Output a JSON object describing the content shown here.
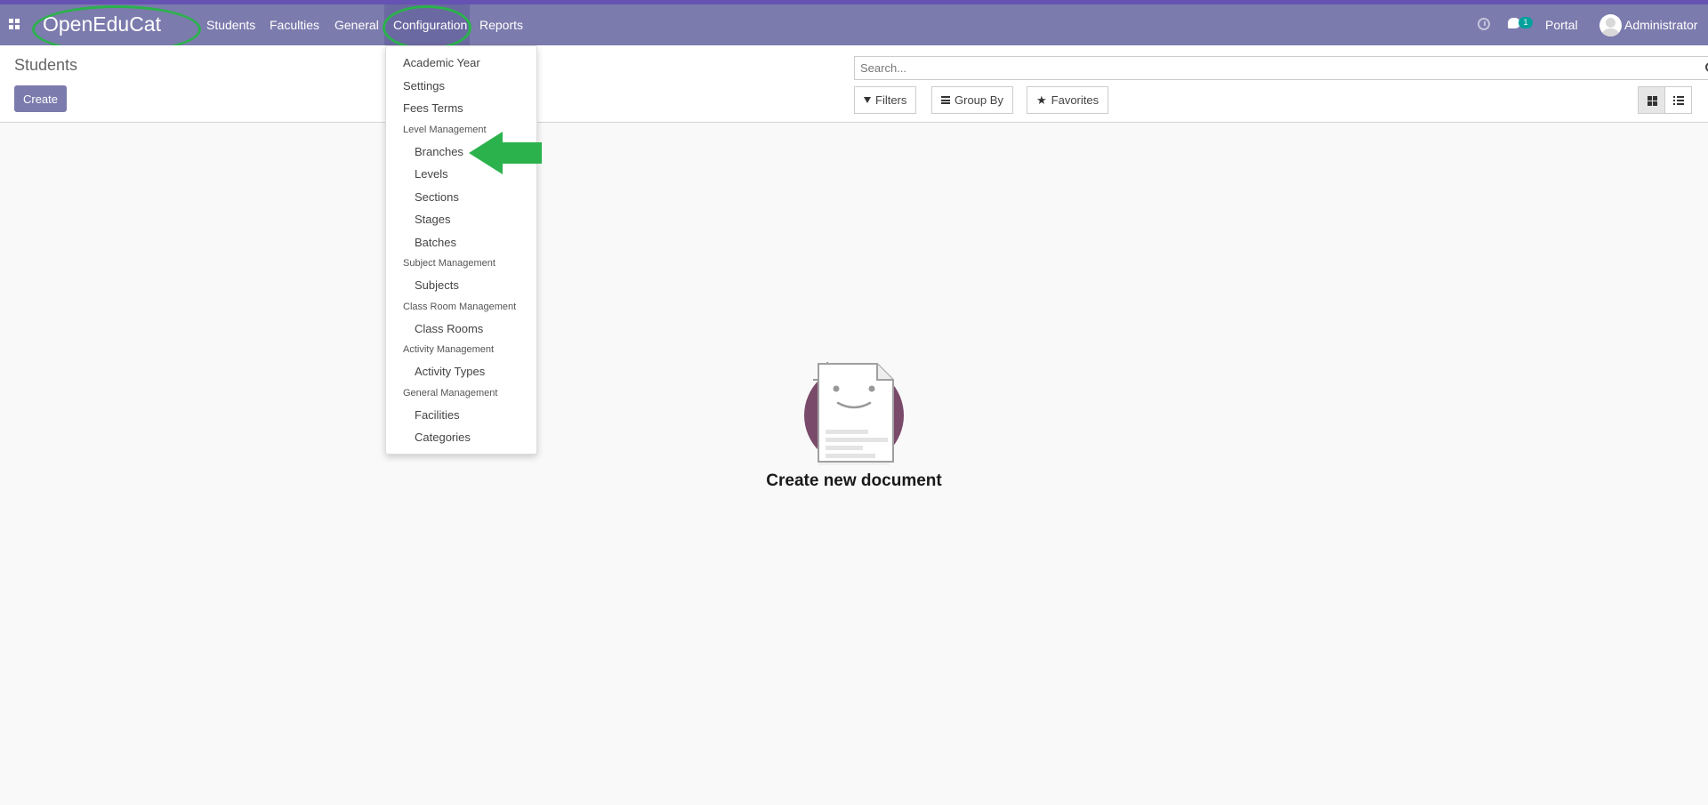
{
  "navbar": {
    "brand": "OpenEduCat",
    "menu": [
      "Students",
      "Faculties",
      "General",
      "Configuration",
      "Reports"
    ],
    "chat_count": "1",
    "portal": "Portal",
    "user": "Administrator",
    "color": "#7c7bad"
  },
  "control_panel": {
    "breadcrumb": "Students",
    "create_label": "Create",
    "search_placeholder": "Search...",
    "filters_label": "Filters",
    "groupby_label": "Group By",
    "favorites_label": "Favorites"
  },
  "dropdown": {
    "items": [
      {
        "label": "Academic Year",
        "type": "item"
      },
      {
        "label": "Settings",
        "type": "item"
      },
      {
        "label": "Fees Terms",
        "type": "item"
      },
      {
        "label": "Level Management",
        "type": "header"
      },
      {
        "label": "Branches",
        "type": "subitem"
      },
      {
        "label": "Levels",
        "type": "subitem"
      },
      {
        "label": "Sections",
        "type": "subitem"
      },
      {
        "label": "Stages",
        "type": "subitem"
      },
      {
        "label": "Batches",
        "type": "subitem"
      },
      {
        "label": "Subject Management",
        "type": "header"
      },
      {
        "label": "Subjects",
        "type": "subitem"
      },
      {
        "label": "Class Room Management",
        "type": "header"
      },
      {
        "label": "Class Rooms",
        "type": "subitem"
      },
      {
        "label": "Activity Management",
        "type": "header"
      },
      {
        "label": "Activity Types",
        "type": "subitem"
      },
      {
        "label": "General Management",
        "type": "header"
      },
      {
        "label": "Facilities",
        "type": "subitem"
      },
      {
        "label": "Categories",
        "type": "subitem"
      }
    ]
  },
  "empty_state": {
    "title": "Create new document"
  },
  "annotation_color": "#2bb24c"
}
